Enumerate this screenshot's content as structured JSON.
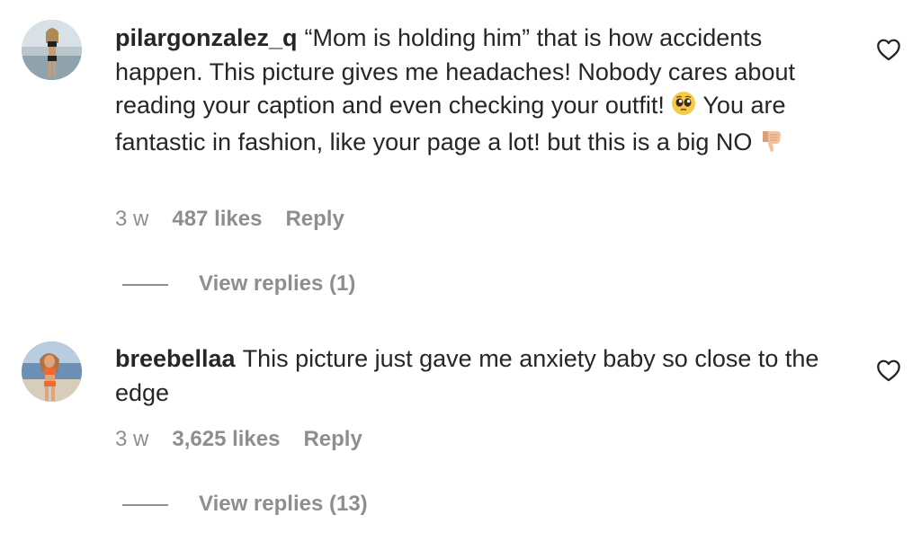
{
  "comments": [
    {
      "username": "pilargonzalez_q",
      "text_part1": "“Mom is holding him” that is how accidents happen. This picture gives me headaches! Nobody cares about reading your caption and even checking your outfit! ",
      "emoji1": "pleading-face",
      "text_part2": " You are fantastic in fashion, like your page a lot! but this is a big NO ",
      "emoji2": "thumbs-down",
      "time": "3 w",
      "likes": "487 likes",
      "reply": "Reply",
      "view_replies": "View replies (1)"
    },
    {
      "username": "breebellaa",
      "text": "This picture just gave me anxiety baby so close to the edge",
      "time": "3 w",
      "likes": "3,625 likes",
      "reply": "Reply",
      "view_replies": "View replies (13)"
    }
  ],
  "colors": {
    "text": "#262626",
    "secondary": "#8e8e8e",
    "background": "#ffffff"
  },
  "icons": {
    "like": "heart-outline-icon"
  }
}
